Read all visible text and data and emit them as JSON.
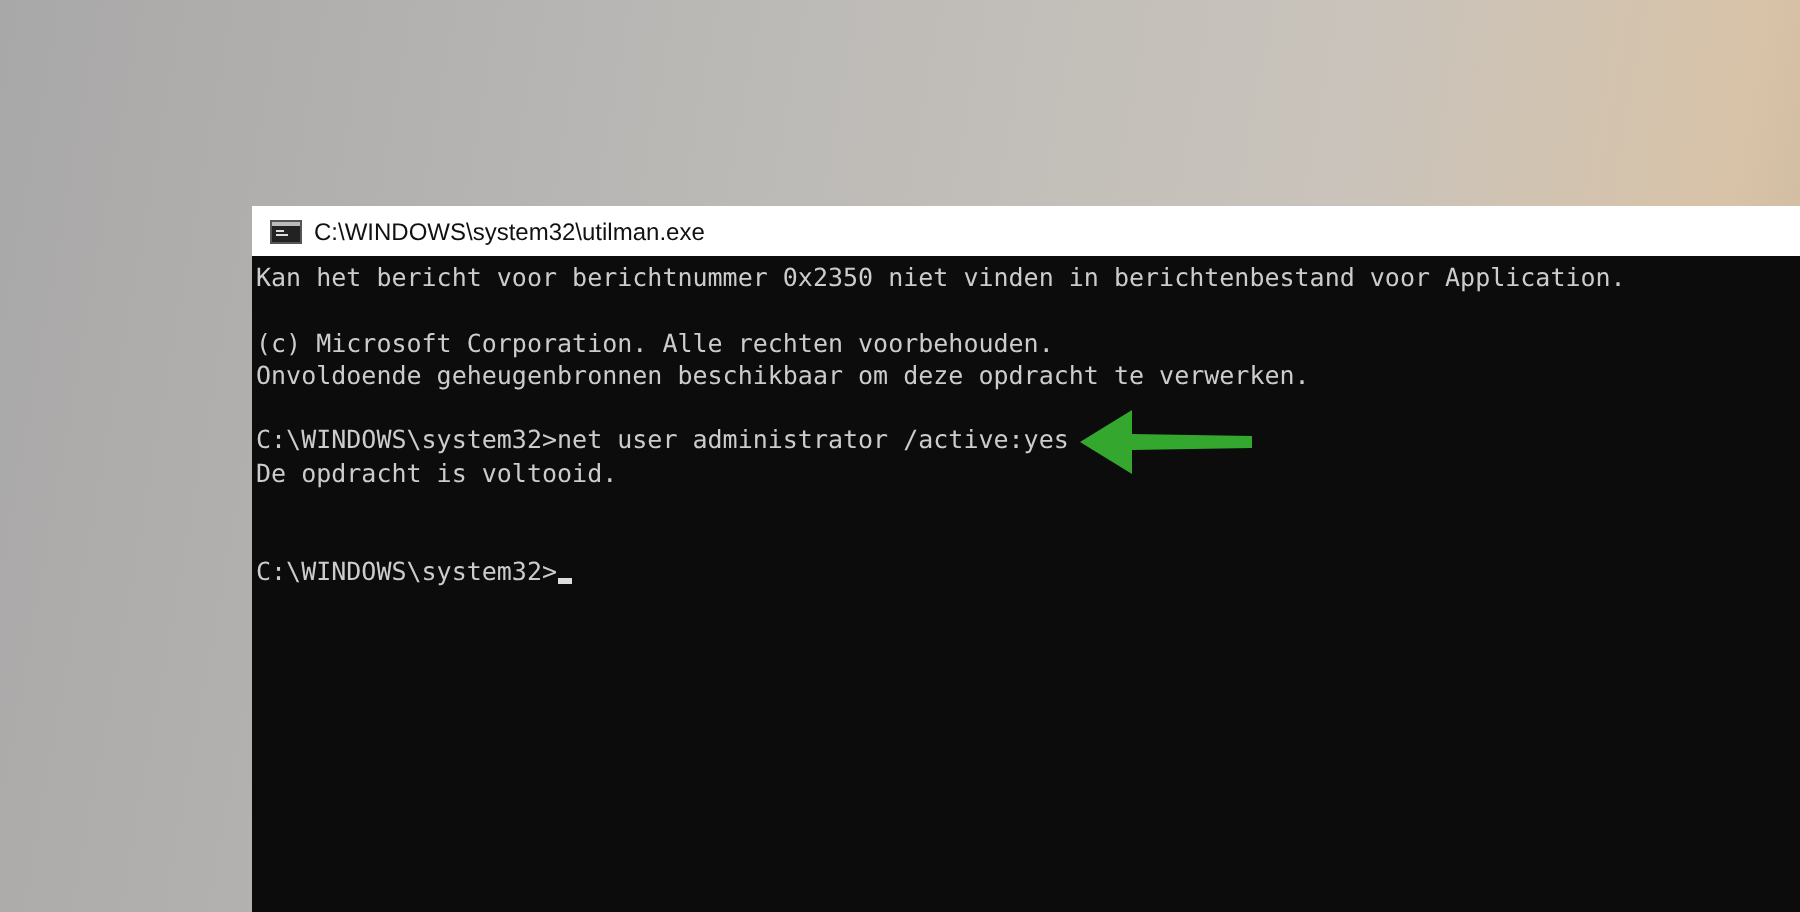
{
  "window": {
    "title": "C:\\WINDOWS\\system32\\utilman.exe"
  },
  "console": {
    "lines": [
      {
        "kind": "output",
        "text": "Kan het bericht voor berichtnummer 0x2350 niet vinden in berichtenbestand voor Application."
      },
      {
        "kind": "blank"
      },
      {
        "kind": "output",
        "text": "(c) Microsoft Corporation. Alle rechten voorbehouden."
      },
      {
        "kind": "output",
        "text": "Onvoldoende geheugenbronnen beschikbaar om deze opdracht te verwerken."
      },
      {
        "kind": "blank"
      },
      {
        "kind": "command",
        "text": "C:\\WINDOWS\\system32>net user administrator /active:yes",
        "arrow": true
      },
      {
        "kind": "output",
        "text": "De opdracht is voltooid."
      },
      {
        "kind": "blank"
      },
      {
        "kind": "blank"
      },
      {
        "kind": "command",
        "text": "C:\\WINDOWS\\system32>",
        "cursor": true
      }
    ]
  }
}
